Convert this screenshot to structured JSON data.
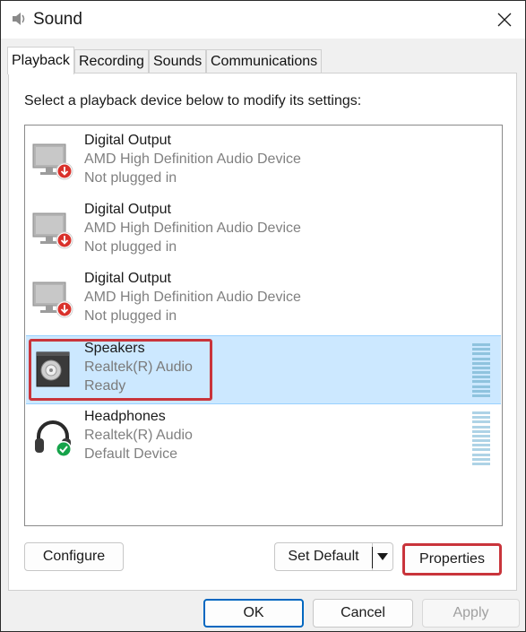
{
  "window": {
    "title": "Sound",
    "close_glyph": "✕"
  },
  "tabs": [
    {
      "label": "Playback",
      "active": true
    },
    {
      "label": "Recording",
      "active": false
    },
    {
      "label": "Sounds",
      "active": false
    },
    {
      "label": "Communications",
      "active": false
    }
  ],
  "playback": {
    "instruction": "Select a playback device below to modify its settings:",
    "devices": [
      {
        "name": "Digital Output",
        "description": "AMD High Definition Audio Device",
        "status": "Not plugged in",
        "icon": "monitor-unplugged-icon",
        "selected": false
      },
      {
        "name": "Digital Output",
        "description": "AMD High Definition Audio Device",
        "status": "Not plugged in",
        "icon": "monitor-unplugged-icon",
        "selected": false
      },
      {
        "name": "Digital Output",
        "description": "AMD High Definition Audio Device",
        "status": "Not plugged in",
        "icon": "monitor-unplugged-icon",
        "selected": false
      },
      {
        "name": "Speakers",
        "description": "Realtek(R) Audio",
        "status": "Ready",
        "icon": "speaker-icon",
        "selected": true
      },
      {
        "name": "Headphones",
        "description": "Realtek(R) Audio",
        "status": "Default Device",
        "icon": "headphones-default-icon",
        "selected": false
      }
    ],
    "configure_label": "Configure",
    "set_default_label": "Set Default",
    "properties_label": "Properties"
  },
  "footer": {
    "ok_label": "OK",
    "cancel_label": "Cancel",
    "apply_label": "Apply"
  },
  "colors": {
    "selection": "#cce8ff",
    "highlight_annotation": "#c9343b",
    "default_button_border": "#0067c0"
  }
}
